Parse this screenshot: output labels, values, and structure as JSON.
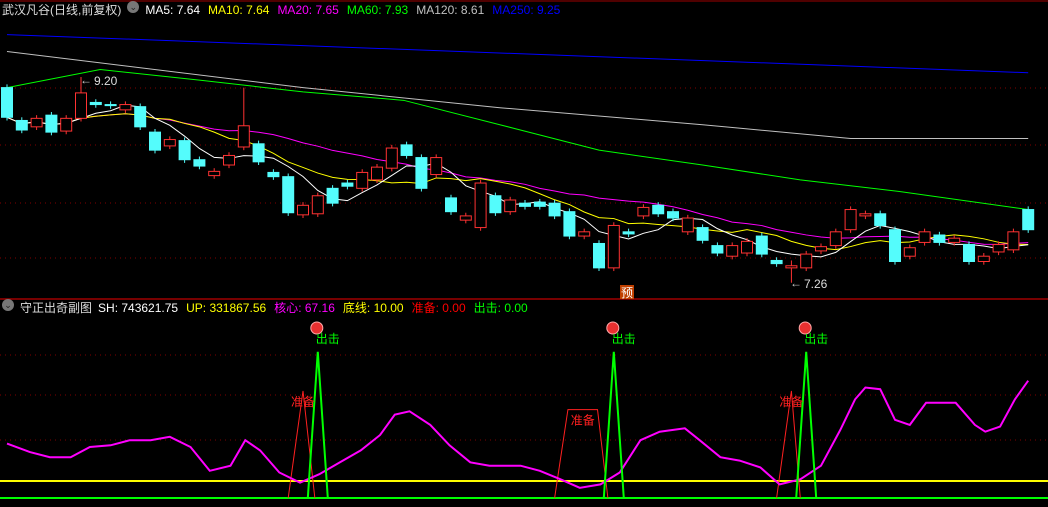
{
  "main": {
    "title": "武汉凡谷(日线,前复权)",
    "ma_labels": [
      {
        "name": "MA5",
        "value": "7.64",
        "color": "#ffffff"
      },
      {
        "name": "MA10",
        "value": "7.64",
        "color": "#ffff00"
      },
      {
        "name": "MA20",
        "value": "7.65",
        "color": "#ff00ff"
      },
      {
        "name": "MA60",
        "value": "7.93",
        "color": "#00ff00"
      },
      {
        "name": "MA120",
        "value": "8.61",
        "color": "#c0c0c0"
      },
      {
        "name": "MA250",
        "value": "9.25",
        "color": "#0000ff"
      }
    ],
    "high_label": "9.20",
    "low_label": "7.26",
    "forecast_badge": "预"
  },
  "sub": {
    "title": "守正出奇副图",
    "indicators": [
      {
        "name": "SH",
        "value": "743621.75",
        "color": "#ffffff"
      },
      {
        "name": "UP",
        "value": "331867.56",
        "color": "#ffff00"
      },
      {
        "name": "核心",
        "value": "67.16",
        "color": "#ff00ff"
      },
      {
        "name": "底线",
        "value": "10.00",
        "color": "#ffff00"
      },
      {
        "name": "准备",
        "value": "0.00",
        "color": "#ff0000"
      },
      {
        "name": "出击",
        "value": "0.00",
        "color": "#00ff00"
      }
    ],
    "signal_attack": "出击",
    "signal_prepare": "准备"
  },
  "colors": {
    "up": "#ff3232",
    "down": "#54fcfc",
    "grid": "#800000",
    "separator": "#a00000"
  },
  "chart_data": {
    "type": "candlestick",
    "price_range": [
      7.2,
      9.7
    ],
    "candles": [
      [
        9.1,
        8.82
      ],
      [
        8.79,
        8.7
      ],
      [
        8.73,
        8.81
      ],
      [
        8.84,
        8.68
      ],
      [
        8.69,
        8.81
      ],
      [
        8.81,
        9.05,
        9.2,
        8.78
      ],
      [
        8.96,
        8.94
      ],
      [
        8.94,
        8.93
      ],
      [
        8.89,
        8.94
      ],
      [
        8.92,
        8.73
      ],
      [
        8.68,
        8.51
      ],
      [
        8.55,
        8.61
      ],
      [
        8.6,
        8.42
      ],
      [
        8.42,
        8.36
      ],
      [
        8.27,
        8.31
      ],
      [
        8.37,
        8.46
      ],
      [
        8.54,
        8.74,
        9.1,
        8.51
      ],
      [
        8.57,
        8.4
      ],
      [
        8.3,
        8.26
      ],
      [
        8.26,
        7.92
      ],
      [
        7.9,
        7.99
      ],
      [
        7.91,
        8.08
      ],
      [
        8.15,
        8.01
      ],
      [
        8.2,
        8.17
      ],
      [
        8.15,
        8.3
      ],
      [
        8.23,
        8.35
      ],
      [
        8.34,
        8.53
      ],
      [
        8.56,
        8.46
      ],
      [
        8.44,
        8.15
      ],
      [
        8.28,
        8.44
      ],
      [
        8.06,
        7.93
      ],
      [
        7.85,
        7.89
      ],
      [
        7.78,
        8.2
      ],
      [
        8.08,
        7.92
      ],
      [
        7.93,
        8.04
      ],
      [
        8.01,
        7.98
      ],
      [
        8.02,
        7.98
      ],
      [
        8.01,
        7.89
      ],
      [
        7.93,
        7.7
      ],
      [
        7.7,
        7.74
      ],
      [
        7.63,
        7.4
      ],
      [
        7.4,
        7.8
      ],
      [
        7.74,
        7.72
      ],
      [
        7.89,
        7.97
      ],
      [
        7.99,
        7.91
      ],
      [
        7.93,
        7.87
      ],
      [
        7.74,
        7.87
      ],
      [
        7.78,
        7.66
      ],
      [
        7.61,
        7.54
      ],
      [
        7.51,
        7.61
      ],
      [
        7.54,
        7.65
      ],
      [
        7.7,
        7.53
      ],
      [
        7.47,
        7.44
      ],
      [
        7.4,
        7.42,
        7.47,
        7.26
      ],
      [
        7.4,
        7.53
      ],
      [
        7.56,
        7.6
      ],
      [
        7.61,
        7.74
      ],
      [
        7.76,
        7.95
      ],
      [
        7.89,
        7.91
      ],
      [
        7.91,
        7.8
      ],
      [
        7.76,
        7.46
      ],
      [
        7.51,
        7.59
      ],
      [
        7.64,
        7.74
      ],
      [
        7.71,
        7.64
      ],
      [
        7.64,
        7.68
      ],
      [
        7.62,
        7.46
      ],
      [
        7.46,
        7.51
      ],
      [
        7.55,
        7.62
      ],
      [
        7.57,
        7.74
      ],
      [
        7.95,
        7.76
      ]
    ],
    "ma60": [
      [
        0,
        9.1
      ],
      [
        6.3,
        9.27
      ],
      [
        13,
        9.17
      ],
      [
        20,
        9.06
      ],
      [
        26.8,
        8.98
      ],
      [
        33.3,
        8.75
      ],
      [
        40,
        8.51
      ],
      [
        47,
        8.37
      ],
      [
        53.6,
        8.23
      ],
      [
        60.3,
        8.12
      ],
      [
        69,
        7.95
      ]
    ],
    "ma120": [
      [
        0,
        9.44
      ],
      [
        20,
        9.1
      ],
      [
        33.3,
        8.91
      ],
      [
        47,
        8.75
      ],
      [
        57,
        8.62
      ],
      [
        69,
        8.62
      ]
    ],
    "ma250": [
      [
        0,
        9.6
      ],
      [
        69,
        9.24
      ]
    ],
    "sub_range": [
      0,
      100
    ],
    "core": [
      [
        0,
        32
      ],
      [
        1.55,
        27
      ],
      [
        2.9,
        24
      ],
      [
        4.3,
        24
      ],
      [
        5.6,
        30
      ],
      [
        7,
        31
      ],
      [
        8.3,
        34
      ],
      [
        9.7,
        34
      ],
      [
        11,
        36
      ],
      [
        12.4,
        30
      ],
      [
        13.7,
        16
      ],
      [
        15.1,
        19
      ],
      [
        16.1,
        34
      ],
      [
        17.1,
        28
      ],
      [
        18.4,
        15
      ],
      [
        19.8,
        9
      ],
      [
        21.1,
        14
      ],
      [
        22.5,
        21
      ],
      [
        23.9,
        28
      ],
      [
        25.2,
        37
      ],
      [
        26.2,
        49
      ],
      [
        27.2,
        51
      ],
      [
        28.6,
        43
      ],
      [
        29.9,
        31
      ],
      [
        31.3,
        21
      ],
      [
        32.6,
        19
      ],
      [
        34.7,
        19
      ],
      [
        36,
        16
      ],
      [
        37.4,
        11
      ],
      [
        38.7,
        6
      ],
      [
        40.1,
        8
      ],
      [
        41.4,
        15
      ],
      [
        42.8,
        34
      ],
      [
        44.1,
        39
      ],
      [
        45.8,
        41
      ],
      [
        46.8,
        34
      ],
      [
        48.2,
        24
      ],
      [
        49.5,
        22
      ],
      [
        50.9,
        18
      ],
      [
        52.2,
        8
      ],
      [
        53.6,
        11
      ],
      [
        55,
        19
      ],
      [
        56.3,
        40
      ],
      [
        57.3,
        58
      ],
      [
        58,
        65
      ],
      [
        59,
        64
      ],
      [
        60,
        46
      ],
      [
        61,
        43
      ],
      [
        62.1,
        56
      ],
      [
        63.4,
        56
      ],
      [
        64.1,
        56
      ],
      [
        65.4,
        43
      ],
      [
        66.1,
        39
      ],
      [
        67.1,
        42
      ],
      [
        68.1,
        58
      ],
      [
        69,
        69
      ]
    ],
    "baseline": 10,
    "attack_peaks": [
      21,
      41,
      54
    ],
    "attack_height": 86,
    "prepare": [
      [
        [
          19,
          0
        ],
        [
          20,
          63
        ],
        [
          20.8,
          0
        ]
      ],
      [
        [
          37,
          0
        ],
        [
          37.9,
          52
        ],
        [
          39.9,
          52
        ],
        [
          40.6,
          0
        ]
      ],
      [
        [
          52,
          0
        ],
        [
          53,
          63
        ],
        [
          53.6,
          0
        ]
      ]
    ]
  }
}
